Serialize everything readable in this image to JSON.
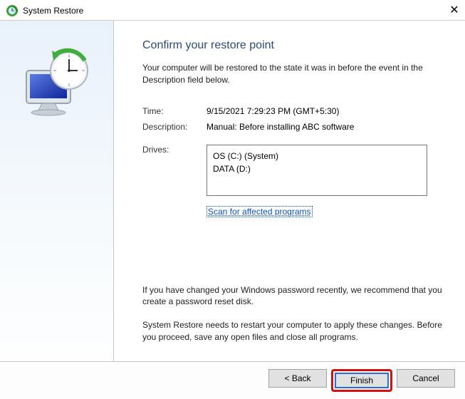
{
  "window": {
    "title": "System Restore"
  },
  "content": {
    "heading": "Confirm your restore point",
    "intro": "Your computer will be restored to the state it was in before the event in the Description field below.",
    "time_label": "Time:",
    "time_value": "9/15/2021 7:29:23 PM (GMT+5:30)",
    "desc_label": "Description:",
    "desc_value": "Manual: Before installing ABC software",
    "drives_label": "Drives:",
    "drives": [
      "OS (C:) (System)",
      "DATA (D:)"
    ],
    "scan_link": "Scan for affected programs",
    "note1": "If you have changed your Windows password recently, we recommend that you create a password reset disk.",
    "note2": "System Restore needs to restart your computer to apply these changes. Before you proceed, save any open files and close all programs."
  },
  "footer": {
    "back": "< Back",
    "finish": "Finish",
    "cancel": "Cancel"
  }
}
